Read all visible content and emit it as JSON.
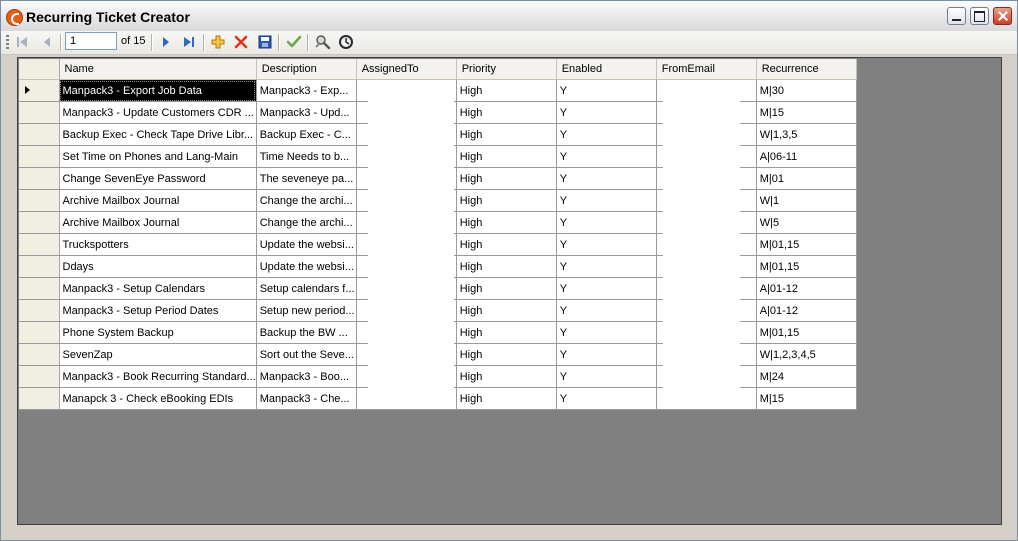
{
  "window": {
    "title": "Recurring Ticket Creator"
  },
  "navigator": {
    "position": "1",
    "count_label": "of 15"
  },
  "icons": {
    "move_first": "move-first-icon",
    "move_previous": "move-previous-icon",
    "move_next": "move-next-icon",
    "move_last": "move-last-icon",
    "add": "add-icon",
    "delete": "delete-icon",
    "save": "save-icon",
    "check": "check-icon",
    "tools": "tools-icon",
    "clock": "clock-icon"
  },
  "colors": {
    "grid_background": "#808080",
    "selected_cell": "#000000"
  },
  "grid": {
    "columns": [
      "Name",
      "Description",
      "AssignedTo",
      "Priority",
      "Enabled",
      "FromEmail",
      "Recurrence"
    ],
    "rows": [
      [
        "Manpack3 - Export Job Data",
        "Manpack3 - Exp...",
        "",
        "High",
        "Y",
        "",
        "M|30"
      ],
      [
        "Manpack3 - Update Customers CDR ...",
        "Manpack3 - Upd...",
        "",
        "High",
        "Y",
        "",
        "M|15"
      ],
      [
        "Backup Exec - Check Tape Drive Libr...",
        "Backup Exec - C...",
        "",
        "High",
        "Y",
        "",
        "W|1,3,5"
      ],
      [
        "Set Time on Phones and Lang-Main",
        "Time Needs to b...",
        "",
        "High",
        "Y",
        "",
        "A|06-11"
      ],
      [
        "Change SevenEye Password",
        "The seveneye pa...",
        "",
        "High",
        "Y",
        "",
        "M|01"
      ],
      [
        "Archive Mailbox Journal",
        "Change the archi...",
        "",
        "High",
        "Y",
        "",
        "W|1"
      ],
      [
        "Archive Mailbox Journal",
        "Change the archi...",
        "",
        "High",
        "Y",
        "",
        "W|5"
      ],
      [
        "Truckspotters",
        "Update the websi...",
        "",
        "High",
        "Y",
        "",
        "M|01,15"
      ],
      [
        "Ddays",
        "Update the websi...",
        "",
        "High",
        "Y",
        "",
        "M|01,15"
      ],
      [
        "Manpack3 - Setup Calendars",
        "Setup calendars f...",
        "",
        "High",
        "Y",
        "",
        "A|01-12"
      ],
      [
        "Manpack3 - Setup Period Dates",
        "Setup new period...",
        "",
        "High",
        "Y",
        "",
        "A|01-12"
      ],
      [
        "Phone System Backup",
        "Backup the BW ...",
        "",
        "High",
        "Y",
        "",
        "M|01,15"
      ],
      [
        "SevenZap",
        "Sort out the Seve...",
        "",
        "High",
        "Y",
        "",
        "W|1,2,3,4,5"
      ],
      [
        "Manpack3 - Book Recurring Standard...",
        "Manpack3 - Boo...",
        "",
        "High",
        "Y",
        "",
        "M|24"
      ],
      [
        "Manapck 3 - Check eBooking EDIs",
        "Manpack3 - Che...",
        "",
        "High",
        "Y",
        "",
        "M|15"
      ]
    ]
  }
}
